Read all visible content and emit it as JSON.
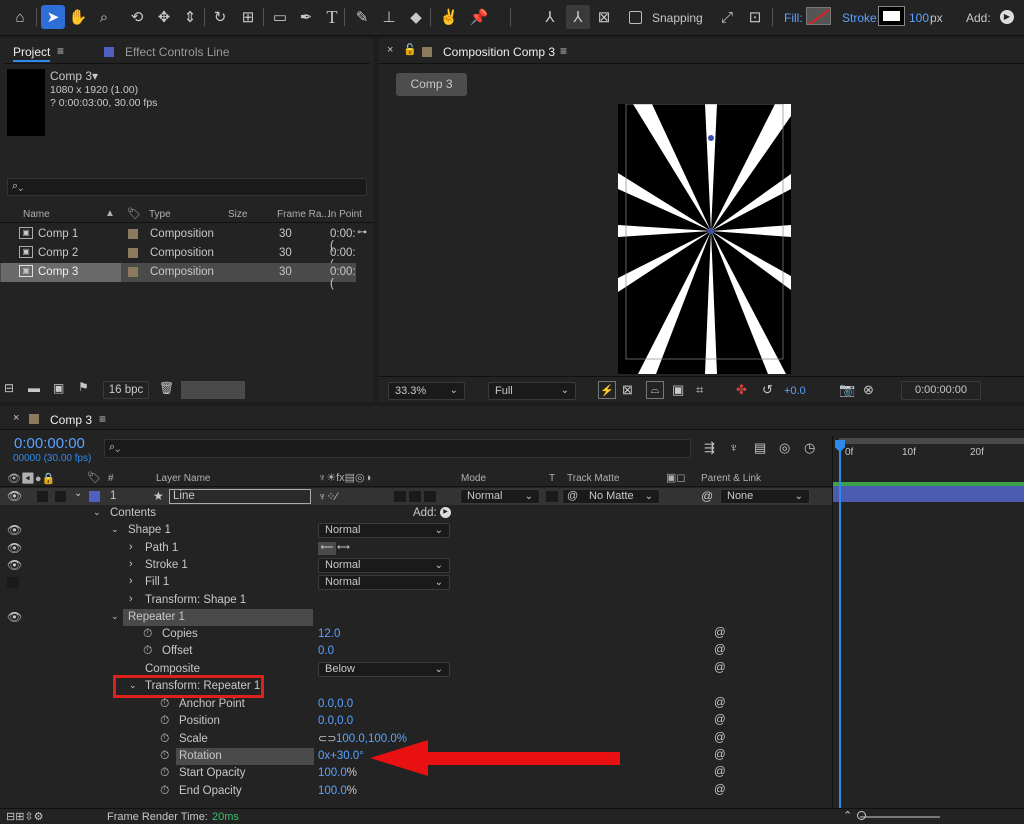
{
  "toolbar": {
    "snapping_label": "Snapping",
    "fill_label": "Fill:",
    "stroke_label": "Stroke:",
    "stroke_width": "100",
    "stroke_unit": "px",
    "add_label": "Add:"
  },
  "project": {
    "tab_label": "Project",
    "effect_tab_label": "Effect Controls Line",
    "comp_name": "Comp 3▾",
    "comp_size": "1080 x 1920 (1.00)",
    "comp_duration": "? 0:00:03:00, 30.00 fps",
    "columns": [
      "Name",
      "Type",
      "Size",
      "Frame Ra...",
      "In Point"
    ],
    "items": [
      {
        "name": "Comp 1",
        "type": "Composition",
        "fps": "30",
        "in": "0:00:("
      },
      {
        "name": "Comp 2",
        "type": "Composition",
        "fps": "30",
        "in": "0:00:("
      },
      {
        "name": "Comp 3",
        "type": "Composition",
        "fps": "30",
        "in": "0:00:("
      }
    ],
    "bpc": "16 bpc"
  },
  "viewer": {
    "tab_label": "Composition Comp 3",
    "comp_button": "Comp 3",
    "zoom": "33.3%",
    "resolution": "Full",
    "exposure": "+0.0",
    "timecode": "0:00:00:00"
  },
  "timeline": {
    "tab_label": "Comp 3",
    "timecode": "0:00:00:00",
    "frames": "00000 (30.00 fps)",
    "col_layer_name": "Layer Name",
    "col_mode": "Mode",
    "col_t": "T",
    "col_trackmatte": "Track Matte",
    "col_parent": "Parent & Link",
    "layer_index": "1",
    "layer_name": "Line",
    "layer_mode": "Normal",
    "layer_matte": "No Matte",
    "layer_parent": "None",
    "contents": "Contents",
    "add": "Add:",
    "shape1": "Shape 1",
    "shape1_mode": "Normal",
    "path1": "Path 1",
    "stroke1": "Stroke 1",
    "stroke1_mode": "Normal",
    "fill1": "Fill 1",
    "fill1_mode": "Normal",
    "transform_shape": "Transform: Shape 1",
    "repeater": "Repeater 1",
    "copies_label": "Copies",
    "copies": "12.0",
    "offset_label": "Offset",
    "offset": "0.0",
    "composite_label": "Composite",
    "composite": "Below",
    "transform_rep": "Transform: Repeater 1",
    "anchor_label": "Anchor Point",
    "anchor": "0.0,0.0",
    "position_label": "Position",
    "position": "0.0,0.0",
    "scale_label": "Scale",
    "scale": "100.0,100.0%",
    "rotation_label": "Rotation",
    "rotation": "0x+30.0°",
    "start_op_label": "Start Opacity",
    "start_op": "100.0",
    "end_op_label": "End Opacity",
    "end_op": "100.0",
    "percent": "%",
    "ruler": [
      "0f",
      "10f",
      "20f"
    ],
    "render_label": "Frame Render Time:",
    "render_value": "20ms"
  },
  "colors": {
    "accent": "#2d8ceb",
    "highlight_box": "#e0201b",
    "arrow": "#e81010",
    "layer_bar": "#4a5bb0"
  }
}
